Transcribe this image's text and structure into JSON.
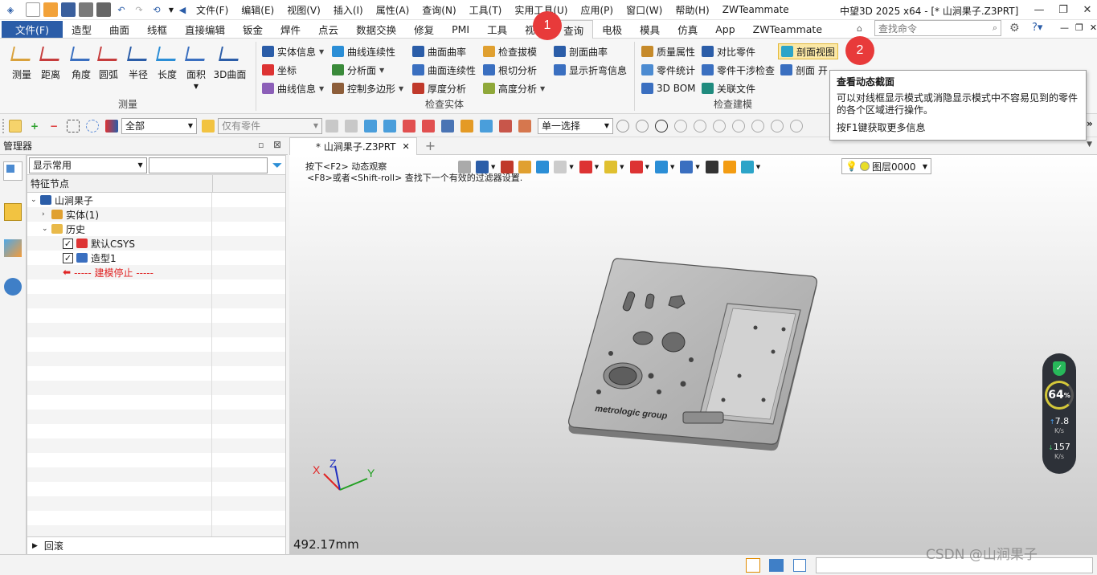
{
  "titlebar": {
    "menus": [
      "文件(F)",
      "编辑(E)",
      "视图(V)",
      "插入(I)",
      "属性(A)",
      "查询(N)",
      "工具(T)",
      "实用工具(U)",
      "应用(P)",
      "窗口(W)",
      "帮助(H)",
      "ZWTeammate"
    ],
    "window_title": "中望3D 2025 x64 - [* 山涧果子.Z3PRT]"
  },
  "tabs": [
    "文件(F)",
    "造型",
    "曲面",
    "线框",
    "直接编辑",
    "钣金",
    "焊件",
    "点云",
    "数据交换",
    "修复",
    "PMI",
    "工具",
    "视觉",
    "查询",
    "电极",
    "模具",
    "仿真",
    "App",
    "ZWTeammate"
  ],
  "active_tab": "查询",
  "search": {
    "placeholder": "查找命令"
  },
  "ribbon": {
    "measure_group": {
      "label": "测量",
      "buttons": [
        "测量",
        "距离",
        "角度",
        "圆弧",
        "半径",
        "长度",
        "面积",
        "3D曲面"
      ]
    },
    "check_entity_group": {
      "label": "检查实体",
      "col1": [
        "实体信息",
        "坐标",
        "曲线信息"
      ],
      "col2": [
        "曲线连续性",
        "分析面",
        "控制多边形"
      ],
      "col3": [
        "曲面曲率",
        "曲面连续性",
        "厚度分析"
      ],
      "col4": [
        "检查拔模",
        "根切分析",
        "高度分析"
      ],
      "col5": [
        "剖面曲率",
        "显示折弯信息"
      ]
    },
    "check_model_group": {
      "label": "检查建模",
      "col1": [
        "质量属性",
        "零件统计",
        "3D BOM"
      ],
      "col2": [
        "对比零件",
        "零件干涉检查",
        "关联文件"
      ],
      "col3": [
        "剖面视图",
        "剖面 开"
      ]
    }
  },
  "tooltip": {
    "title": "查看动态截面",
    "body": "可以对线框显示模式或消隐显示模式中不容易见到的零件的各个区域进行操作。",
    "hint": "按F1键获取更多信息"
  },
  "callouts": [
    "1",
    "2"
  ],
  "toolbar2": {
    "filter_value": "全部",
    "part_filter": "仅有零件",
    "select_mode": "单一选择"
  },
  "manager": {
    "title": "管理器",
    "view_combo": "显示常用",
    "column_header": "特征节点",
    "tree": [
      {
        "label": "山涧果子",
        "level": 0,
        "icon": "assembly-icon"
      },
      {
        "label": "实体(1)",
        "level": 1,
        "icon": "solid-icon"
      },
      {
        "label": "历史",
        "level": 1,
        "icon": "folder-icon"
      },
      {
        "label": "默认CSYS",
        "level": 2,
        "icon": "csys-icon",
        "checked": true
      },
      {
        "label": "造型1",
        "level": 2,
        "icon": "shape-icon",
        "checked": true
      },
      {
        "label": "----- 建模停止 -----",
        "level": 2,
        "icon": "stop-arrow-icon"
      }
    ],
    "footer": "回滚"
  },
  "viewport": {
    "tab_title": "* 山涧果子.Z3PRT",
    "hint1": "按下<F2> 动态观察",
    "hint2": "<F8>或者<Shift-roll> 查找下一个有效的过滤器设置.",
    "layer": "图层0000",
    "scale": "492.17mm",
    "engraving": "metrologic group",
    "axes": [
      "X",
      "Z",
      "Y"
    ]
  },
  "perf": {
    "percent": "64",
    "pct_sign": "%",
    "up": "7.8",
    "down": "157",
    "unit": "K/s"
  },
  "watermark": "CSDN @山涧果子",
  "colors": {
    "accent": "#2b5da8",
    "callout": "#e83a3a",
    "active_btn": "#fbe8a6"
  }
}
